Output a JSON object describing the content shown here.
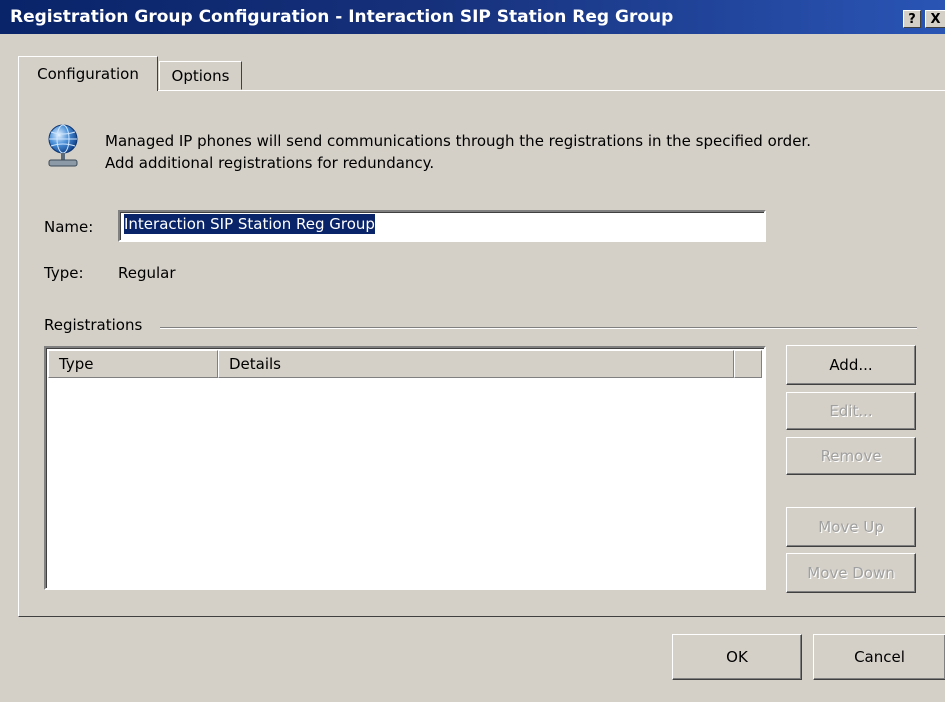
{
  "window": {
    "title": "Registration Group Configuration - Interaction SIP Station Reg Group",
    "help_button": "?",
    "close_button": "X"
  },
  "tabs": [
    {
      "label": "Configuration",
      "selected": true
    },
    {
      "label": "Options",
      "selected": false
    }
  ],
  "info": {
    "icon": "globe-network-icon",
    "line1": "Managed IP phones will send communications through the registrations in the specified order.",
    "line2": "Add additional registrations for redundancy."
  },
  "form": {
    "name_label": "Name:",
    "name_value": "Interaction SIP Station Reg Group",
    "type_label": "Type:",
    "type_value": "Regular"
  },
  "registrations": {
    "group_label": "Registrations",
    "columns": [
      "Type",
      "Details"
    ],
    "rows": [],
    "buttons": {
      "add": "Add...",
      "edit": "Edit...",
      "remove": "Remove",
      "move_up": "Move Up",
      "move_down": "Move Down"
    },
    "disabled": [
      "edit",
      "remove",
      "move_up",
      "move_down"
    ]
  },
  "footer": {
    "ok": "OK",
    "cancel": "Cancel"
  },
  "colors": {
    "titlebar": "#0a246a",
    "dialog_bg": "#d4d0c8",
    "selection": "#0a246a"
  }
}
